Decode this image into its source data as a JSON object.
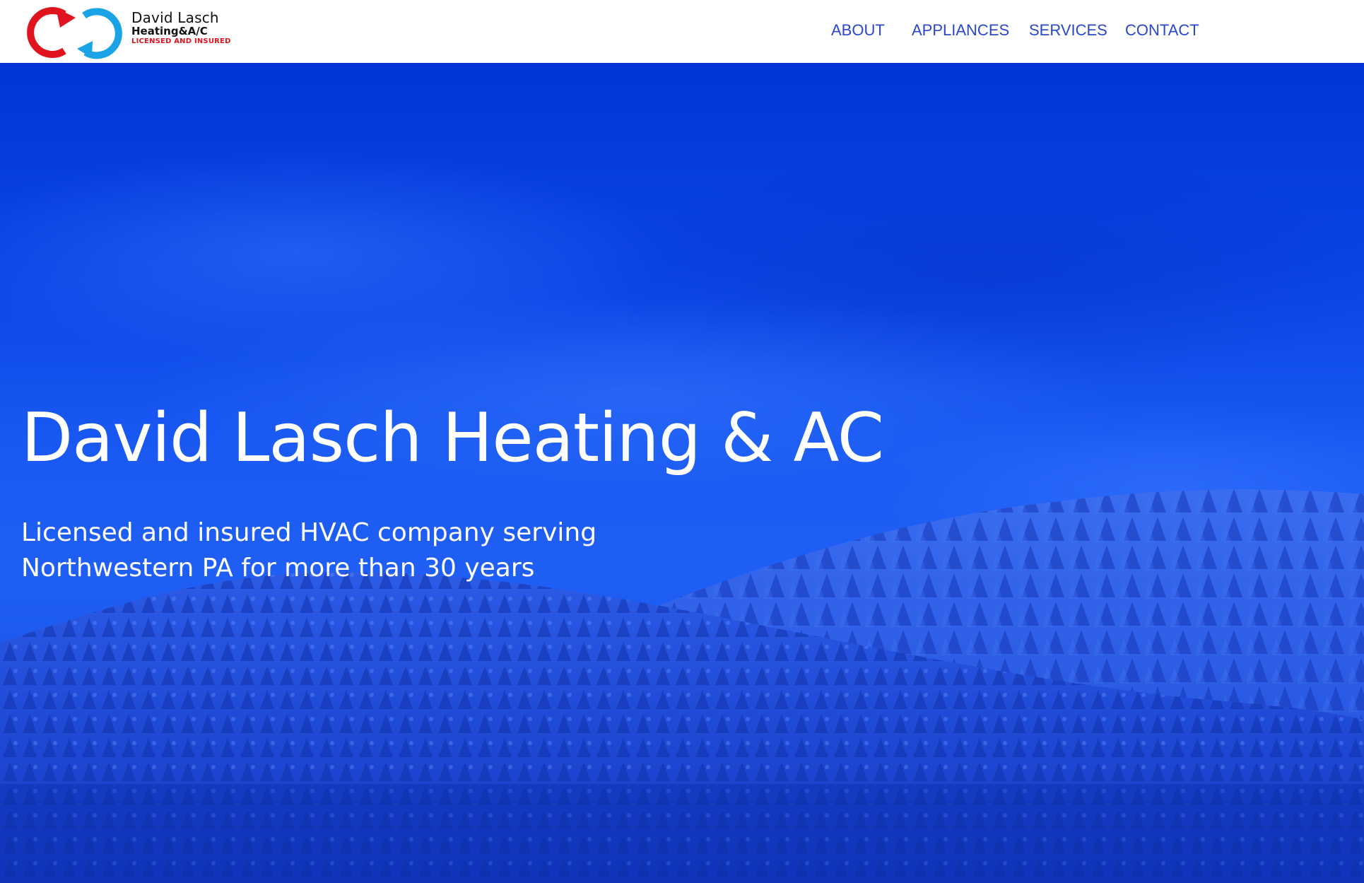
{
  "header": {
    "logo": {
      "name_line": "David Lasch",
      "trade_line": "Heating&A/C",
      "tagline": "LICENSED AND INSURED"
    },
    "nav": [
      {
        "label": "ABOUT"
      },
      {
        "label": "APPLIANCES"
      },
      {
        "label": "SERVICES"
      },
      {
        "label": "CONTACT"
      }
    ]
  },
  "hero": {
    "title": "David Lasch Heating & AC",
    "subtitle_lines": [
      "Licensed and insured HVAC company serving",
      "Northwestern PA for more than 30 years"
    ],
    "background": "snowy-forested-hills-photo"
  },
  "colors": {
    "nav_link": "#2947cc",
    "hero_blue": "#1f5ff5",
    "logo_red": "#e0141e",
    "logo_blue": "#1aa3e6"
  }
}
